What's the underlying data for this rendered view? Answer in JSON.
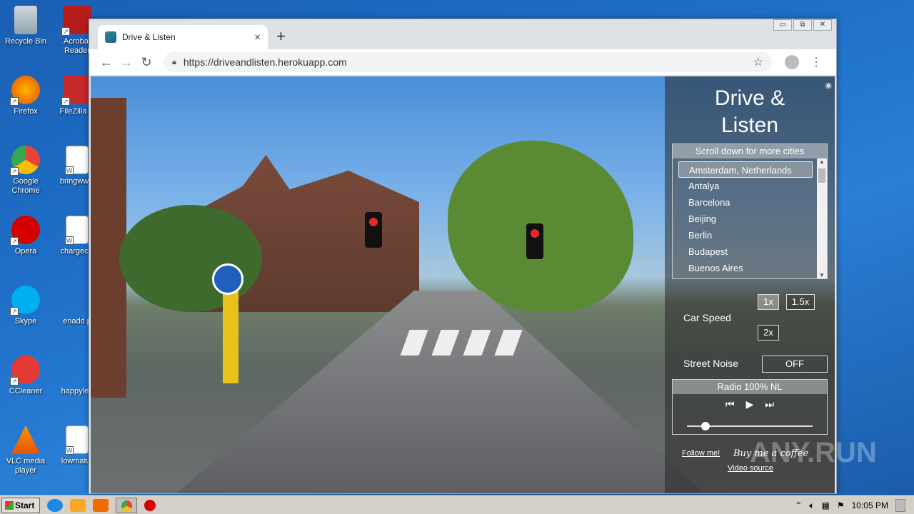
{
  "desktop": {
    "icons": [
      {
        "label": "Recycle Bin",
        "icon": "recycle-bin-icon"
      },
      {
        "label": "Acrobat Reader",
        "icon": "acrobat-icon"
      },
      {
        "label": "Firefox",
        "icon": "firefox-icon"
      },
      {
        "label": "FileZilla C",
        "icon": "filezilla-icon"
      },
      {
        "label": "Google Chrome",
        "icon": "chrome-icon"
      },
      {
        "label": "bringwww",
        "icon": "word-doc-icon"
      },
      {
        "label": "Opera",
        "icon": "opera-icon"
      },
      {
        "label": "chargeciv",
        "icon": "word-doc-icon"
      },
      {
        "label": "Skype",
        "icon": "skype-icon"
      },
      {
        "label": "enadd.p",
        "icon": "file-icon"
      },
      {
        "label": "CCleaner",
        "icon": "ccleaner-icon"
      },
      {
        "label": "happylea",
        "icon": "file-icon"
      },
      {
        "label": "VLC media player",
        "icon": "vlc-icon"
      },
      {
        "label": "lowmatur",
        "icon": "word-doc-icon"
      }
    ]
  },
  "browser": {
    "tab_title": "Drive & Listen",
    "new_tab": "+",
    "tab_close": "×",
    "url": "https://driveandlisten.herokuapp.com",
    "window_controls": [
      "▭",
      "⧉",
      "✕"
    ]
  },
  "app": {
    "title_line1": "Drive &",
    "title_line2": "Listen",
    "city_header": "Scroll down for more cities",
    "cities": [
      "Amsterdam, Netherlands",
      "Antalya",
      "Barcelona",
      "Beijing",
      "Berlin",
      "Budapest",
      "Buenos Aires"
    ],
    "selected_city": "Amsterdam, Netherlands",
    "car_speed_label": "Car Speed",
    "speeds": [
      "1x",
      "1.5x",
      "2x"
    ],
    "selected_speed": "1x",
    "street_noise_label": "Street Noise",
    "street_noise_value": "OFF",
    "radio_station": "Radio 100% NL",
    "volume_level": 0.15,
    "follow_link": "Follow me!",
    "coffee_link": "Buy me a coffee",
    "video_source_link": "Video source"
  },
  "taskbar": {
    "start_label": "Start",
    "clock": "10:05 PM"
  },
  "watermark": "ANY.RUN"
}
